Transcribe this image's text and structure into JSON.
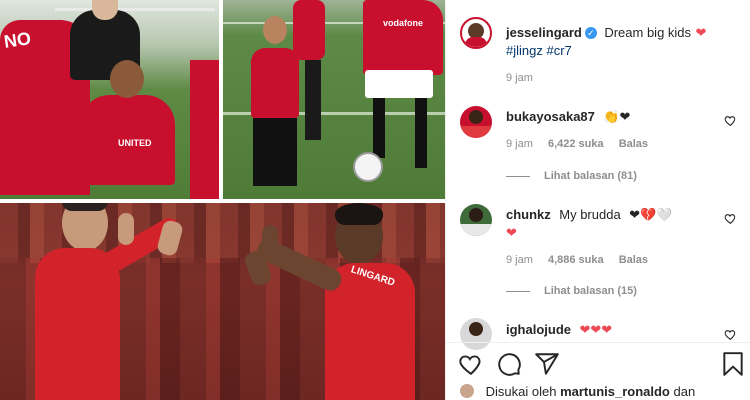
{
  "post": {
    "author": "jesselingard",
    "caption_text": "Dream big kids",
    "caption_emoji": "❤",
    "hashtags": "#jlingz #cr7",
    "time": "9 jam"
  },
  "comments": [
    {
      "user": "bukayosaka87",
      "text": "",
      "emoji": "👏❤",
      "time": "9 jam",
      "likes": "6,422 suka",
      "reply": "Balas",
      "view_replies": "Lihat balasan (81)"
    },
    {
      "user": "chunkz",
      "text": "My brudda",
      "emoji": "❤💔🤍",
      "emoji2": "❤",
      "time": "9 jam",
      "likes": "4,886 suka",
      "reply": "Balas",
      "view_replies": "Lihat balasan (15)"
    },
    {
      "user": "ighalojude",
      "text": "",
      "emoji": "❤❤❤"
    }
  ],
  "likes_bar": {
    "prefix": "Disukai oleh",
    "user": "martunis_ronaldo",
    "suffix": "dan"
  },
  "media_text": {
    "jersey_back": "NO",
    "jersey_sponsor": "vodafone",
    "kid_shirt_sponsor": "UNITED",
    "name_print": "LINGARD"
  },
  "colors": {
    "verified": "#3897f0",
    "heart_red": "#ed4956",
    "link_blue": "#00376b",
    "meta_gray": "#8e8e8e",
    "united_red": "#c8102e"
  },
  "icons": [
    "heart-icon",
    "comment-icon",
    "share-icon",
    "bookmark-icon",
    "verified-icon"
  ]
}
